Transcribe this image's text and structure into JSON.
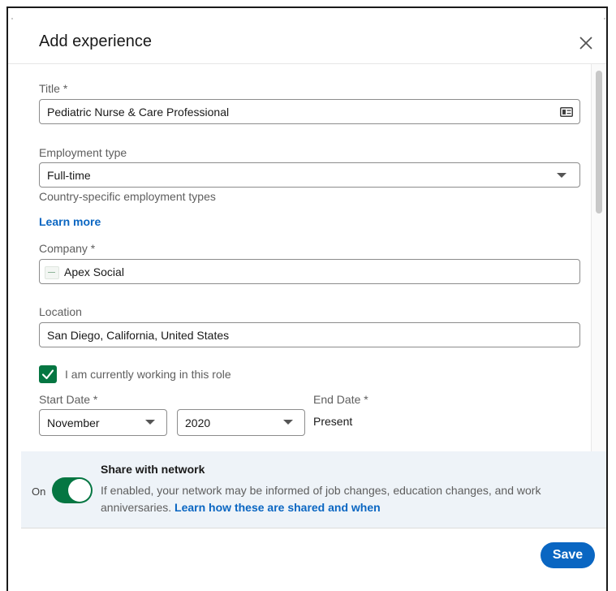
{
  "dialog": {
    "title": "Add experience",
    "close_icon": "close-icon"
  },
  "form": {
    "title": {
      "label": "Title *",
      "value": "Pediatric Nurse & Care Professional",
      "icon": "contact-card-icon"
    },
    "employment_type": {
      "label": "Employment type",
      "value": "Full-time",
      "helper": "Country-specific employment types",
      "link": "Learn more"
    },
    "company": {
      "label": "Company *",
      "value": "Apex Social",
      "icon": "company-logo"
    },
    "location": {
      "label": "Location",
      "value": "San Diego, California, United States"
    },
    "currently_working": {
      "checked": true,
      "label": "I am currently working in this role"
    },
    "start_date": {
      "label": "Start Date *",
      "month": "November",
      "year": "2020"
    },
    "end_date": {
      "label": "End Date *",
      "value": "Present"
    }
  },
  "share": {
    "toggle_label": "On",
    "toggle_on": true,
    "title": "Share with network",
    "description": "If enabled, your network may be informed of job changes, education changes, and work anniversaries.",
    "link": "Learn how these are shared and when"
  },
  "footer": {
    "save_label": "Save"
  },
  "colors": {
    "primary": "#0a66c2",
    "toggle_green": "#057642",
    "share_bg": "#eef3f8"
  }
}
